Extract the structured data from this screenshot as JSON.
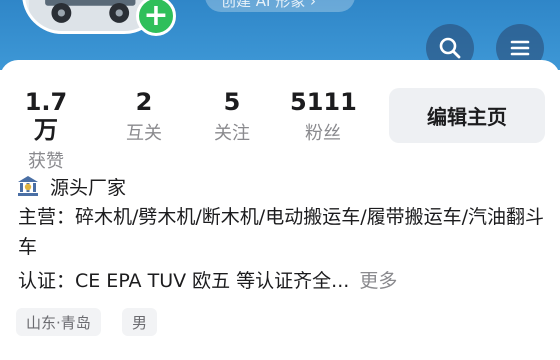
{
  "header": {
    "ai_pill_label": "创建 AI 形象 ›"
  },
  "stats": [
    {
      "value": "1.7万",
      "label": "获赞"
    },
    {
      "value": "2",
      "label": "互关"
    },
    {
      "value": "5",
      "label": "关注"
    },
    {
      "value": "5111",
      "label": "粉丝"
    }
  ],
  "edit_button_label": "编辑主页",
  "account": {
    "type_label": "源头厂家",
    "bio": "主营：碎木机/劈木机/断木机/电动搬运车/履带搬运车/汽油翻斗车",
    "cert": "认证：CE EPA TUV 欧五 等认证齐全...",
    "more_label": "更多"
  },
  "tags": [
    "山东·青岛",
    "男"
  ],
  "colors": {
    "header_blue": "#3e98d6",
    "plus_green": "#2fbf5a",
    "muted_text": "#8a8a8e"
  },
  "icons": [
    "plus-icon",
    "search-icon",
    "menu-icon",
    "bank-icon"
  ]
}
